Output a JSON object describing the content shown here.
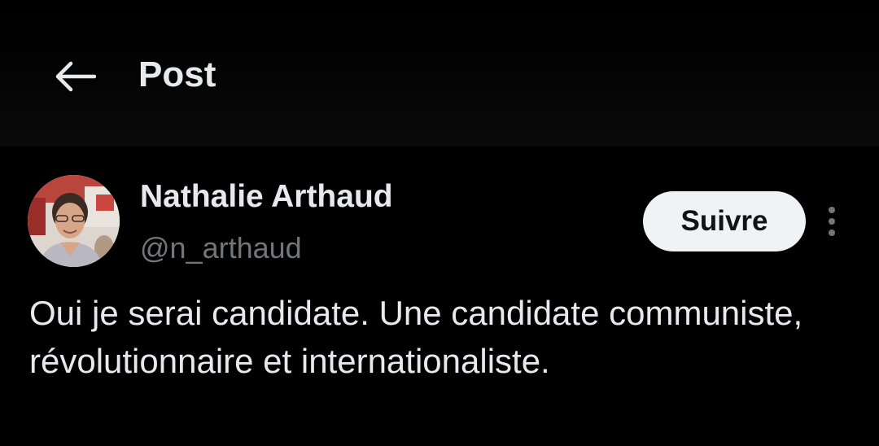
{
  "header": {
    "back_icon": "arrow-left-icon",
    "title": "Post"
  },
  "post": {
    "author": {
      "name": "Nathalie Arthaud",
      "handle": "@n_arthaud",
      "avatar": "profile-photo"
    },
    "follow_label": "Suivre",
    "more_icon": "vertical-ellipsis-icon",
    "text": "Oui je serai candidate. Une candidate communiste, révolutionnaire et internationaliste."
  },
  "colors": {
    "background": "#000000",
    "text_primary": "#e7e9ea",
    "text_secondary": "#71767b",
    "button_bg": "#eff3f4",
    "button_text": "#0f1419"
  }
}
